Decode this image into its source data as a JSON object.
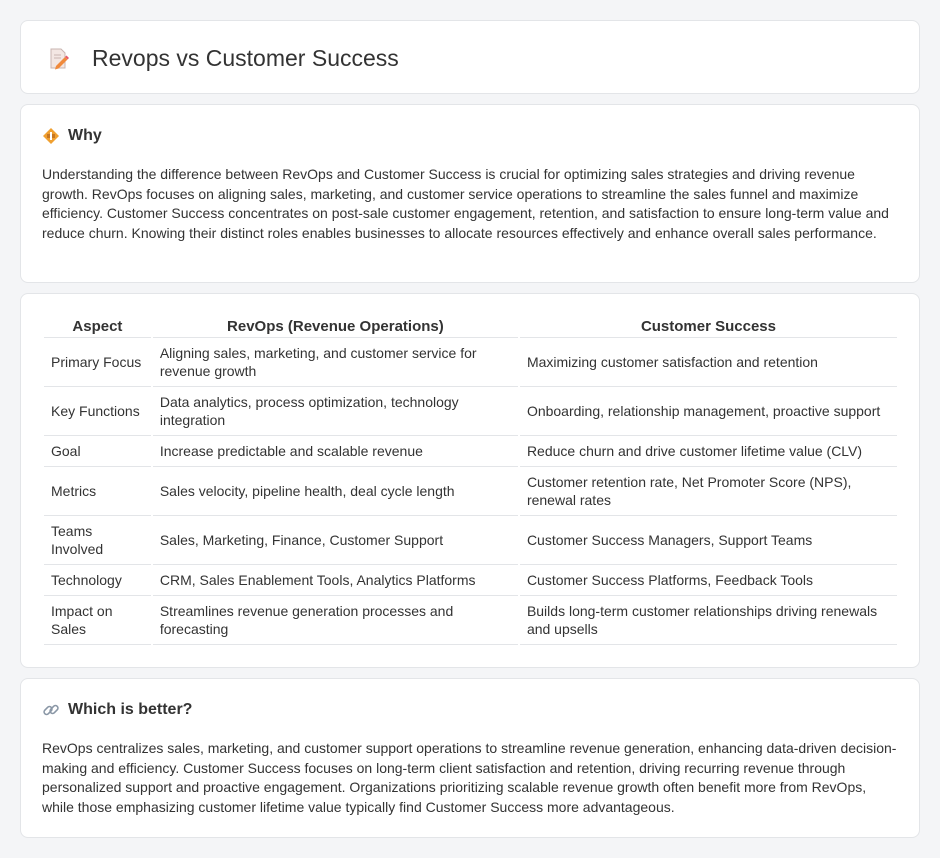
{
  "header": {
    "title": "Revops vs Customer Success",
    "icon": "document-pencil-icon"
  },
  "why": {
    "icon": "diamond-warning-icon",
    "title": "Why",
    "text": "Understanding the difference between RevOps and Customer Success is crucial for optimizing sales strategies and driving revenue growth. RevOps focuses on aligning sales, marketing, and customer service operations to streamline the sales funnel and maximize efficiency. Customer Success concentrates on post-sale customer engagement, retention, and satisfaction to ensure long-term value and reduce churn. Knowing their distinct roles enables businesses to allocate resources effectively and enhance overall sales performance."
  },
  "table": {
    "headers": [
      "Aspect",
      "RevOps (Revenue Operations)",
      "Customer Success"
    ],
    "rows": [
      [
        "Primary Focus",
        "Aligning sales, marketing, and customer service for revenue growth",
        "Maximizing customer satisfaction and retention"
      ],
      [
        "Key Functions",
        "Data analytics, process optimization, technology integration",
        "Onboarding, relationship management, proactive support"
      ],
      [
        "Goal",
        "Increase predictable and scalable revenue",
        "Reduce churn and drive customer lifetime value (CLV)"
      ],
      [
        "Metrics",
        "Sales velocity, pipeline health, deal cycle length",
        "Customer retention rate, Net Promoter Score (NPS), renewal rates"
      ],
      [
        "Teams Involved",
        "Sales, Marketing, Finance, Customer Support",
        "Customer Success Managers, Support Teams"
      ],
      [
        "Technology",
        "CRM, Sales Enablement Tools, Analytics Platforms",
        "Customer Success Platforms, Feedback Tools"
      ],
      [
        "Impact on Sales",
        "Streamlines revenue generation processes and forecasting",
        "Builds long-term customer relationships driving renewals and upsells"
      ]
    ]
  },
  "better": {
    "icon": "link-icon",
    "title": "Which is better?",
    "text": "RevOps centralizes sales, marketing, and customer support operations to streamline revenue generation, enhancing data-driven decision-making and efficiency. Customer Success focuses on long-term client satisfaction and retention, driving recurring revenue through personalized support and proactive engagement. Organizations prioritizing scalable revenue growth often benefit more from RevOps, while those emphasizing customer lifetime value typically find Customer Success more advantageous."
  },
  "colors": {
    "background": "#f4f5f7",
    "card": "#ffffff",
    "border": "#e3e5e8",
    "text": "#333333",
    "accent_orange": "#f0a030"
  }
}
